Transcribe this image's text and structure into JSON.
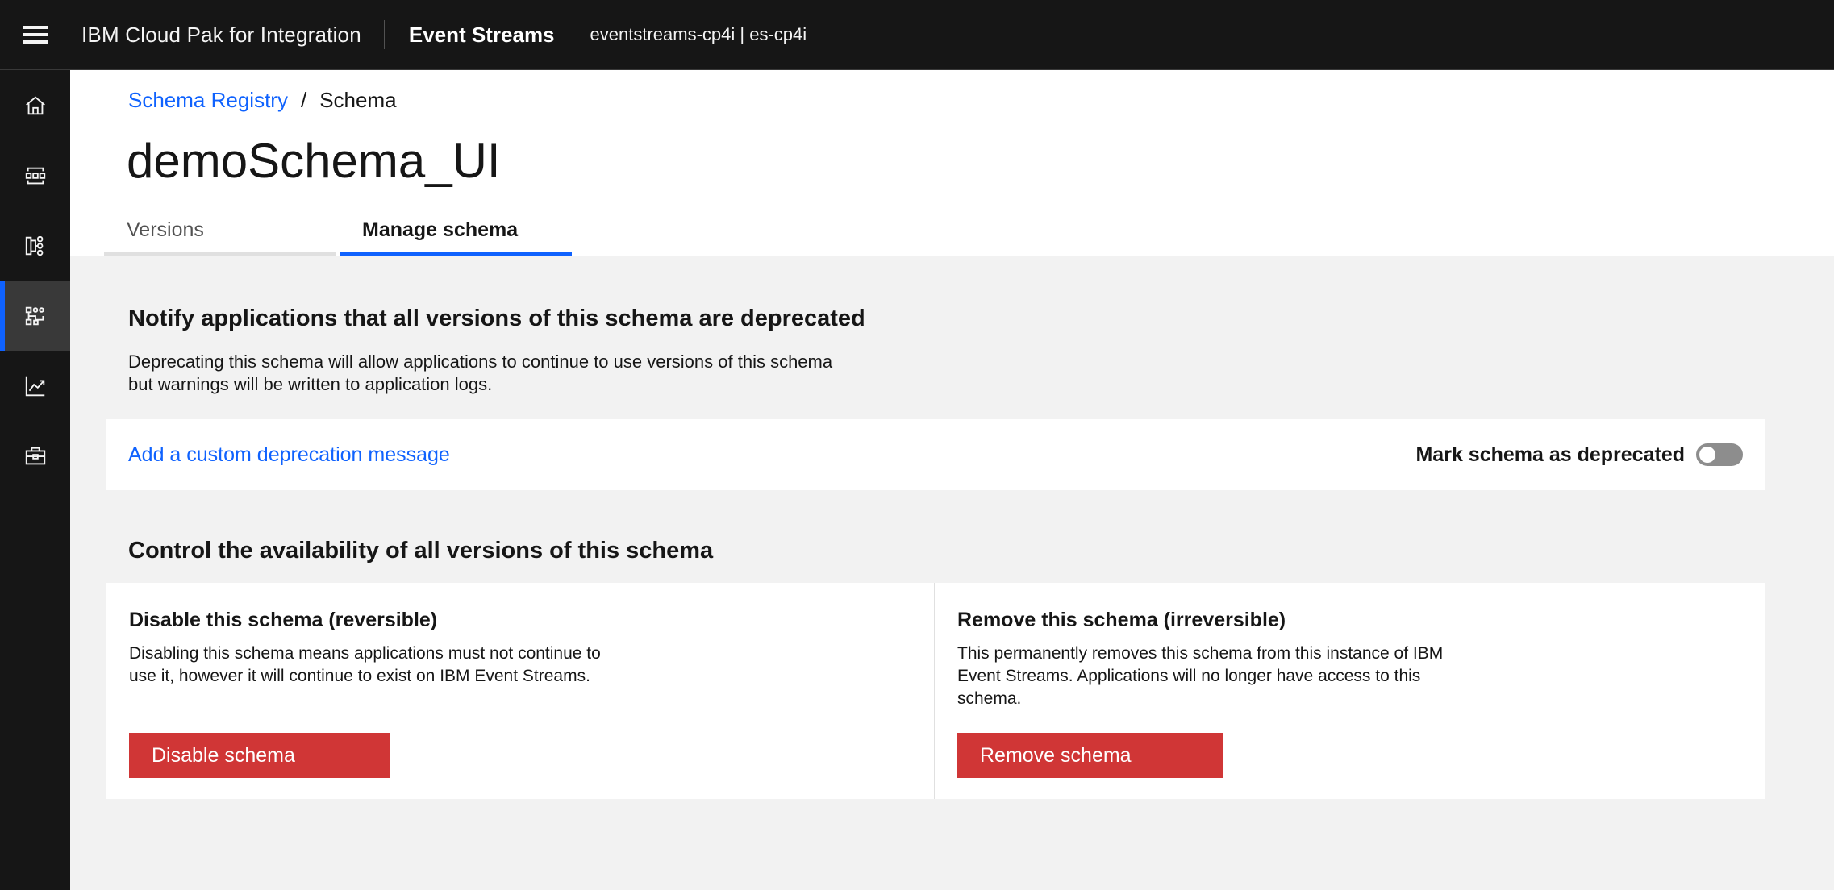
{
  "header": {
    "product_name": "IBM Cloud Pak for Integration",
    "app_name": "Event Streams",
    "instance": "eventstreams-cp4i | es-cp4i"
  },
  "sidebar": {
    "items": [
      {
        "icon": "home-icon",
        "active": false
      },
      {
        "icon": "topics-icon",
        "active": false
      },
      {
        "icon": "consumer-groups-icon",
        "active": false
      },
      {
        "icon": "schema-registry-icon",
        "active": true
      },
      {
        "icon": "monitoring-icon",
        "active": false
      },
      {
        "icon": "toolbox-icon",
        "active": false
      }
    ]
  },
  "breadcrumb": {
    "parent": "Schema Registry",
    "separator": "/",
    "current": "Schema"
  },
  "page": {
    "title": "demoSchema_UI"
  },
  "tabs": [
    {
      "label": "Versions",
      "selected": false
    },
    {
      "label": "Manage schema",
      "selected": true
    }
  ],
  "deprecation": {
    "title": "Notify applications that all versions of this schema are deprecated",
    "description": "Deprecating this schema will allow applications to continue to use versions of this schema but warnings will be written to application logs.",
    "custom_message_link": "Add a custom deprecation message",
    "toggle_label": "Mark schema as deprecated",
    "toggle_on": false
  },
  "availability": {
    "title": "Control the availability of all versions of this schema",
    "disable": {
      "title": "Disable this schema (reversible)",
      "description": "Disabling this schema means applications must not continue to use it, however it will continue to exist on IBM Event Streams.",
      "button": "Disable schema"
    },
    "remove": {
      "title": "Remove this schema (irreversible)",
      "description": "This permanently removes this schema from this instance of IBM Event Streams. Applications will no longer have access to this schema.",
      "button": "Remove schema"
    }
  },
  "colors": {
    "header_bg": "#161616",
    "accent": "#0f62fe",
    "danger": "#d03636",
    "page_bg": "#f2f2f2"
  }
}
